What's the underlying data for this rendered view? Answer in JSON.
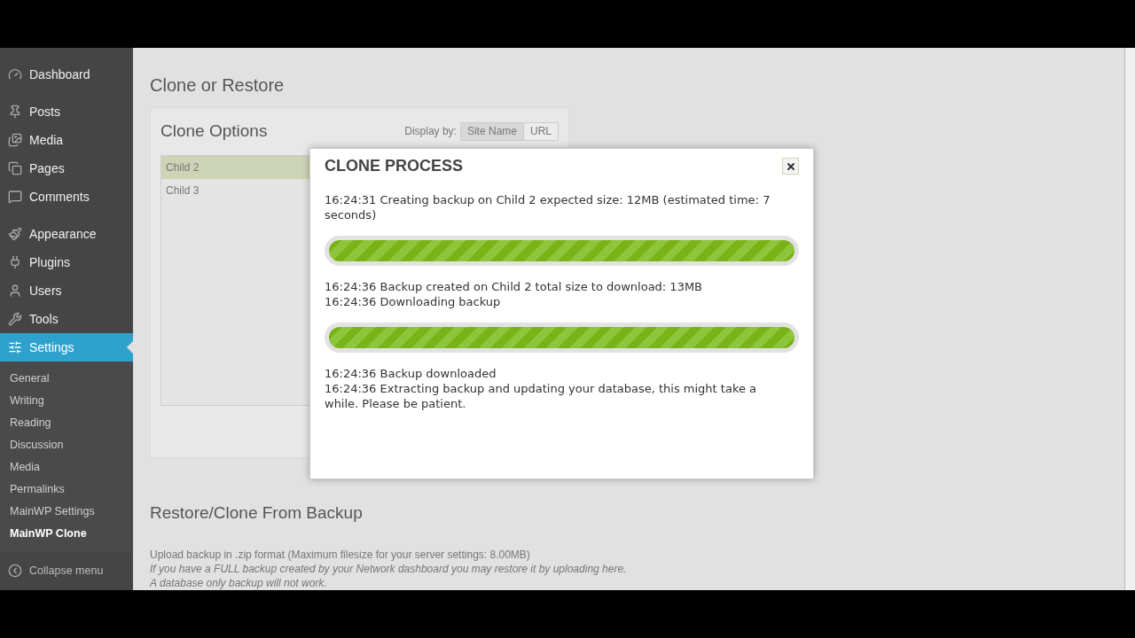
{
  "sidebar": {
    "groups": [
      {
        "items": [
          {
            "label": "Dashboard",
            "kind": "gauge",
            "selected": false
          }
        ]
      },
      {
        "items": [
          {
            "label": "Posts",
            "kind": "pin",
            "selected": false
          },
          {
            "label": "Media",
            "kind": "media",
            "selected": false
          },
          {
            "label": "Pages",
            "kind": "pages",
            "selected": false
          },
          {
            "label": "Comments",
            "kind": "comment",
            "selected": false
          }
        ]
      },
      {
        "items": [
          {
            "label": "Appearance",
            "kind": "brush",
            "selected": false
          },
          {
            "label": "Plugins",
            "kind": "plug",
            "selected": false
          },
          {
            "label": "Users",
            "kind": "user",
            "selected": false
          },
          {
            "label": "Tools",
            "kind": "wrench",
            "selected": false
          },
          {
            "label": "Settings",
            "kind": "sliders",
            "selected": true
          }
        ]
      }
    ],
    "submenu": [
      {
        "label": "General",
        "selected": false
      },
      {
        "label": "Writing",
        "selected": false
      },
      {
        "label": "Reading",
        "selected": false
      },
      {
        "label": "Discussion",
        "selected": false
      },
      {
        "label": "Media",
        "selected": false
      },
      {
        "label": "Permalinks",
        "selected": false
      },
      {
        "label": "MainWP Settings",
        "selected": false
      },
      {
        "label": "MainWP Clone",
        "selected": true
      }
    ],
    "collapse": "Collapse menu"
  },
  "page": {
    "title": "Clone or Restore",
    "clone_options": {
      "title": "Clone Options",
      "display_by": "Display by:",
      "display_options": [
        {
          "label": "Site Name",
          "selected": true
        },
        {
          "label": "URL",
          "selected": false
        }
      ],
      "sites": [
        {
          "label": "Child 2",
          "selected": true
        },
        {
          "label": "Child 3",
          "selected": false
        }
      ]
    },
    "restore": {
      "title": "Restore/Clone From Backup",
      "note": "Upload backup in .zip format (Maximum filesize for your server settings: 8.00MB)",
      "hints": [
        "If you have a FULL backup created by your Network dashboard you may restore it by uploading here.",
        "A database only backup will not work."
      ]
    }
  },
  "dialog": {
    "title": "CLONE PROCESS",
    "blocks": [
      {
        "kind": "text",
        "lines": [
          "16:24:31 Creating backup on Child 2 expected size: 12MB (estimated time: 7 seconds)"
        ]
      },
      {
        "kind": "progress",
        "level": 1
      },
      {
        "kind": "text",
        "lines": [
          "16:24:36 Backup created on Child 2 total size to download: 13MB",
          "16:24:36 Downloading backup"
        ]
      },
      {
        "kind": "progress",
        "level": 1
      },
      {
        "kind": "text",
        "lines": [
          "16:24:36 Backup downloaded",
          "16:24:36 Extracting backup and updating your database, this might take a while. Please be patient."
        ]
      }
    ]
  }
}
